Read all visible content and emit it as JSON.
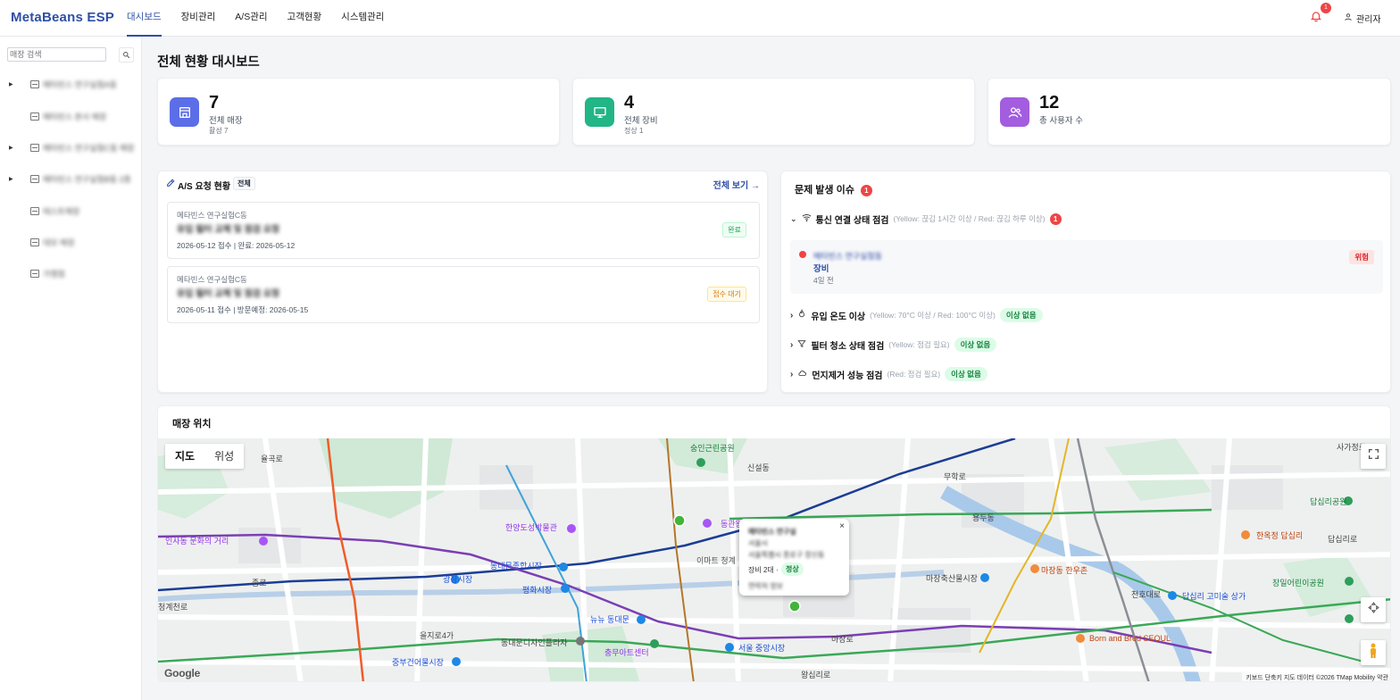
{
  "header": {
    "brand": "MetaBeans ESP",
    "nav": [
      "대시보드",
      "장비관리",
      "A/S관리",
      "고객현황",
      "시스템관리"
    ],
    "active_nav": "대시보드",
    "notification_count": "1",
    "user_label": "관리자"
  },
  "sidebar": {
    "search_placeholder": "매장 검색",
    "stores": [
      {
        "label": "메타빈스 연구실험A동",
        "expandable": true
      },
      {
        "label": "메타빈스 본사 매장",
        "expandable": false
      },
      {
        "label": "메타빈스 연구실험C동 매장",
        "expandable": true
      },
      {
        "label": "메타빈스 연구실험B동 2층",
        "expandable": true
      },
      {
        "label": "테스트매장",
        "expandable": false
      },
      {
        "label": "데모 매장",
        "expandable": false
      },
      {
        "label": "가맹점",
        "expandable": false
      }
    ]
  },
  "page_title": "전체 현황 대시보드",
  "stats": [
    {
      "value": "7",
      "label": "전체 매장",
      "sub": "활성 7",
      "color": "#5b6ee8",
      "icon": "store-icon"
    },
    {
      "value": "4",
      "label": "전체 장비",
      "sub": "정상 1",
      "color": "#22b585",
      "icon": "monitor-icon"
    },
    {
      "value": "12",
      "label": "총 사용자 수",
      "sub": "",
      "color": "#a35ddf",
      "icon": "users-icon"
    }
  ],
  "as_panel": {
    "title": "A/S 요청 현황",
    "filter_tag": "전체",
    "view_all": "전체 보기 →",
    "requests": [
      {
        "store": "메타빈스 연구실험C동",
        "title": "유입 필터 교체 및 점검 요청",
        "date": "2026-05-12 접수 | 완료: 2026-05-12",
        "status": "완료",
        "status_kind": "done"
      },
      {
        "store": "메타빈스 연구실험C동",
        "title": "유입 필터 교체 및 점검 요청",
        "date": "2026-05-11 접수 | 방문예정: 2026-05-15",
        "status": "접수 대기",
        "status_kind": "wait"
      }
    ]
  },
  "issues": {
    "title": "문제 발생 이슈",
    "count": "1",
    "categories": [
      {
        "name": "통신 연결 상태 점검",
        "hint": "(Yellow: 끊김 1시간 이상 / Red: 끊김 하루 이상)",
        "badge": "1",
        "expanded": true
      },
      {
        "name": "유입 온도 이상",
        "hint": "(Yellow: 70°C 이상 / Red: 100°C 이상)",
        "badge": "이상 없음",
        "expanded": false
      },
      {
        "name": "필터 청소 상태 점검",
        "hint": "(Yellow: 점검 필요)",
        "badge": "이상 없음",
        "expanded": false
      },
      {
        "name": "먼지제거 성능 점검",
        "hint": "(Red: 점검 필요)",
        "badge": "이상 없음",
        "expanded": false
      }
    ],
    "alert": {
      "name": "메타빈스 연구실험동",
      "type": "장비",
      "time": "4일 전",
      "level": "위험"
    }
  },
  "map": {
    "title": "매장 위치",
    "toggle": [
      "지도",
      "위성"
    ],
    "active_toggle": "지도",
    "popup": {
      "line1": "메타빈스 연구실",
      "line2": "서울시",
      "line3": "서울특별시 종로구 창신동",
      "device_count": "장비 2대 ·",
      "status": "정상",
      "extra": "연락처 정보"
    },
    "google": "Google",
    "attribution": "키보드 단축키    지도 데이터 ©2026 TMap Mobility    약관",
    "places": [
      "인사동 문화의 거리",
      "광장시장",
      "평화시장",
      "동대문종합시장",
      "한양도성박물관",
      "동관왕묘",
      "숭인근린공원",
      "이마트 청계",
      "뉴뉴 동대문",
      "중부건어물시장",
      "동대문디자인플라자",
      "충무아트센터",
      "서울 중앙시장",
      "마장동 한우촌",
      "마장축산물시장",
      "한옥정 답십리",
      "답십리 고미술 상가",
      "Born and Bred SEOUL",
      "답십리공원",
      "장일어린이공원",
      "신설동",
      "용두동",
      "을지로4가",
      "청계천로",
      "종로",
      "율곡로",
      "왕십리로",
      "마장로",
      "무학로",
      "천호대로",
      "답십리로",
      "사가정로"
    ]
  }
}
